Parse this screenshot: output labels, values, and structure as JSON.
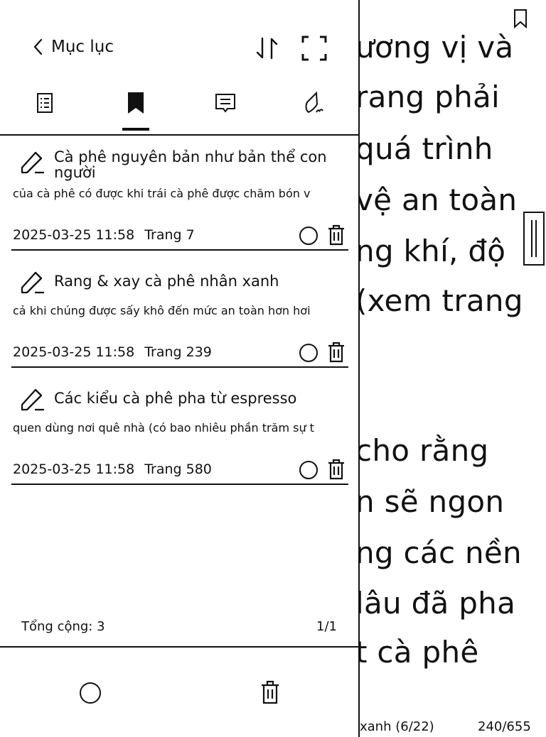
{
  "reader": {
    "lines": [
      "ương vị và",
      "rang phải",
      " quá trình",
      "vệ an toàn",
      "ng khí, độ",
      "(xem trang",
      "",
      "",
      " cho rằng",
      "n sẽ ngon",
      "ng các nền",
      "lâu đã pha",
      "t cà phê"
    ],
    "footer_left": "xanh (6/22)",
    "footer_right": "240/655"
  },
  "panel": {
    "back_label": "Mục lục",
    "tabs": [
      "toc-icon",
      "bookmark-icon",
      "notes-icon",
      "handwriting-icon"
    ],
    "items": [
      {
        "title": "Cà phê nguyên bản như bản thể con người",
        "excerpt": "của cà phê có được khi trái cà phê được chăm bón v",
        "date": "2025-03-25 11:58",
        "page": "Trang 7"
      },
      {
        "title": "Rang & xay cà phê nhân xanh",
        "excerpt": "cả khi chúng được sấy khô đến mức an toàn hơn hơi",
        "date": "2025-03-25 11:58",
        "page": "Trang 239"
      },
      {
        "title": "Các kiểu cà phê pha từ espresso",
        "excerpt": "quen dùng nơi quê nhà (có bao nhiêu phần trăm sự t",
        "date": "2025-03-25 11:58",
        "page": "Trang 580"
      }
    ],
    "total": "Tổng cộng: 3",
    "pager": "1/1"
  }
}
